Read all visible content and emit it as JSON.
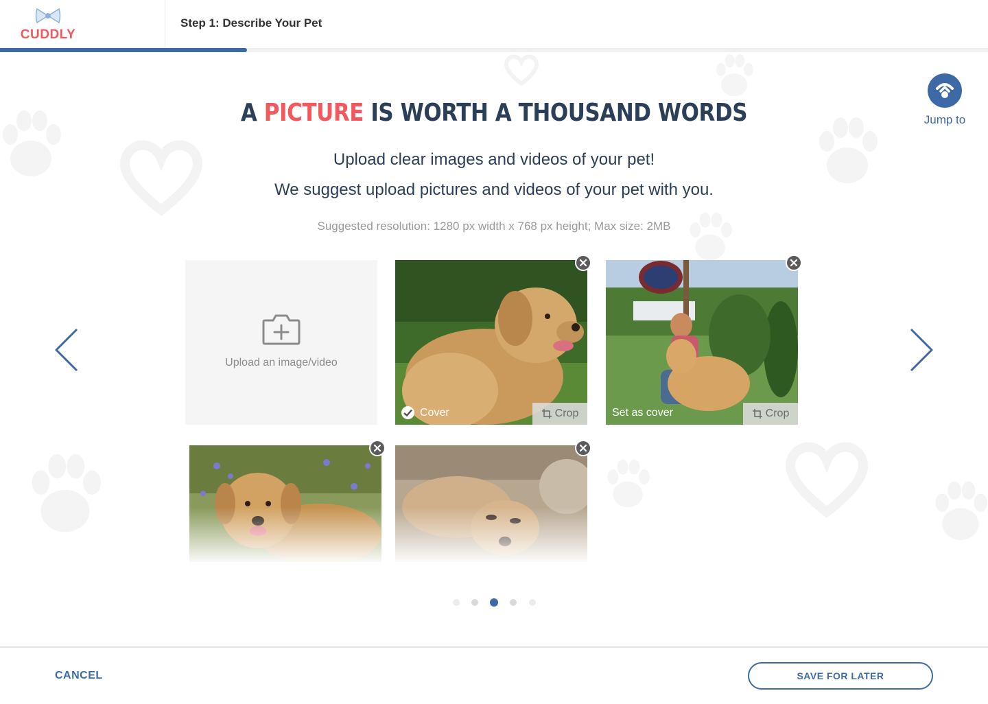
{
  "brand": {
    "name": "CUDDLY",
    "color": "#f2595e"
  },
  "header": {
    "step_title": "Step 1: Describe Your Pet",
    "progress_fraction": 0.25
  },
  "jump_to": {
    "label": "Jump to",
    "icon": "jump-to-icon"
  },
  "headline": {
    "prefix": "A ",
    "accent": "PICTURE",
    "suffix": " IS WORTH A THOUSAND WORDS"
  },
  "subheading": {
    "line1": "Upload clear images and videos of your pet!",
    "line2": "We suggest upload pictures and videos of your pet with you."
  },
  "hint": "Suggested resolution: 1280 px width x 768 px height; Max size: 2MB",
  "upload": {
    "label": "Upload an image/video",
    "icon": "camera-add-icon"
  },
  "photos": [
    {
      "status": "Cover",
      "is_cover": true,
      "crop_label": "Crop"
    },
    {
      "status": "Set as cover",
      "is_cover": false,
      "crop_label": "Crop"
    },
    {
      "status": "",
      "is_cover": false
    },
    {
      "status": "",
      "is_cover": false
    }
  ],
  "pagination": {
    "total": 5,
    "active_index": 2
  },
  "footer": {
    "cancel_label": "CANCEL",
    "save_label": "SAVE FOR LATER"
  },
  "colors": {
    "primary": "#3d6aa6",
    "accent": "#f2595e",
    "text": "#2b3f58"
  }
}
